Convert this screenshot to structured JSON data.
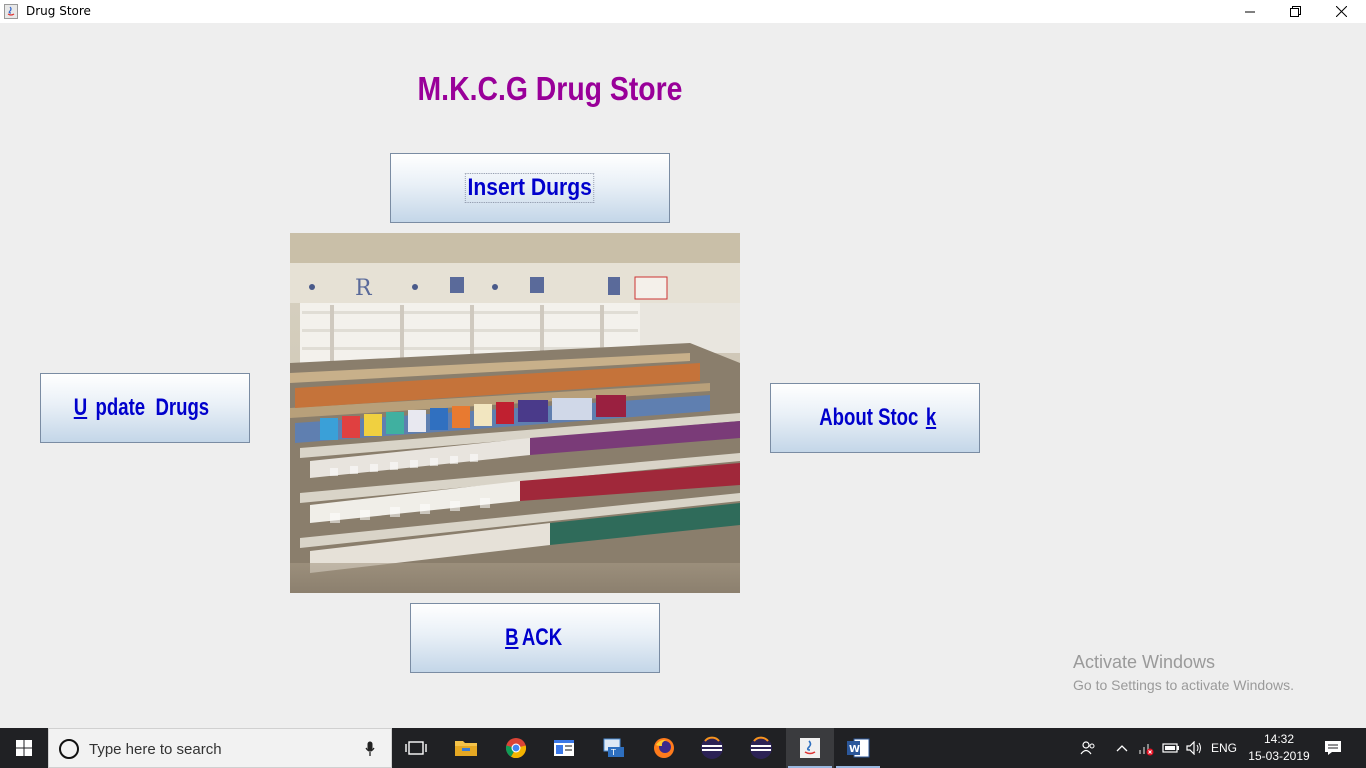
{
  "window": {
    "title": "Drug Store"
  },
  "main": {
    "heading": "M.K.C.G Drug Store",
    "insert_button": "Insert Durgs",
    "update_button_mnemonic": "U",
    "update_button_rest": "pdate  Drugs",
    "about_button_before": "About Stoc",
    "about_button_mnemonic": "k",
    "back_button_mnemonic": "B",
    "back_button_rest": "ACK"
  },
  "watermark": {
    "line1": "Activate Windows",
    "line2": "Go to Settings to activate Windows."
  },
  "taskbar": {
    "search_placeholder": "Type here to search",
    "language": "ENG",
    "time": "14:32",
    "date": "15-03-2019",
    "apps": [
      "task-view",
      "file-explorer",
      "chrome",
      "app-window",
      "network-app",
      "firefox",
      "eclipse",
      "eclipse",
      "java",
      "word"
    ]
  },
  "colors": {
    "heading": "#990099",
    "button_text": "#0000cc",
    "back_text": "#cc0000",
    "window_bg": "#eeeeee"
  }
}
